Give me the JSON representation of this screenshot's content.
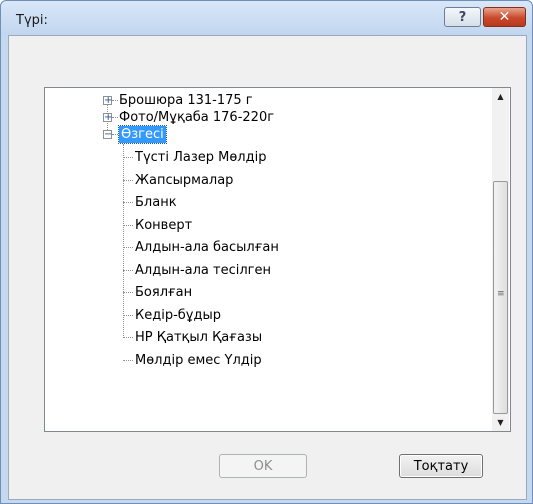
{
  "window": {
    "title": "Түрі:",
    "help_glyph": "?",
    "close_glyph": "✕"
  },
  "tree": {
    "items": [
      {
        "label": "Брошюра 131-175 г",
        "expander": "+"
      },
      {
        "label": "Фото/Мұқаба 176-220г",
        "expander": "+"
      },
      {
        "label": "Өзгесі",
        "expander": "−",
        "selected": true
      },
      {
        "label": "Түсті Лазер Мөлдір"
      },
      {
        "label": "Жапсырмалар"
      },
      {
        "label": "Бланк"
      },
      {
        "label": "Конверт"
      },
      {
        "label": "Алдын-ала басылған"
      },
      {
        "label": "Алдын-ала тесілген"
      },
      {
        "label": "Боялған"
      },
      {
        "label": "Кедір-бұдыр"
      },
      {
        "label": "HP Қатқыл Қағазы"
      },
      {
        "label": "Мөлдір емес Үлдір"
      }
    ]
  },
  "scrollbar": {
    "up_arrow": "▲",
    "down_arrow": "▼",
    "grip": "≡"
  },
  "buttons": {
    "ok_label": "OK",
    "cancel_label": "Тоқтату"
  }
}
